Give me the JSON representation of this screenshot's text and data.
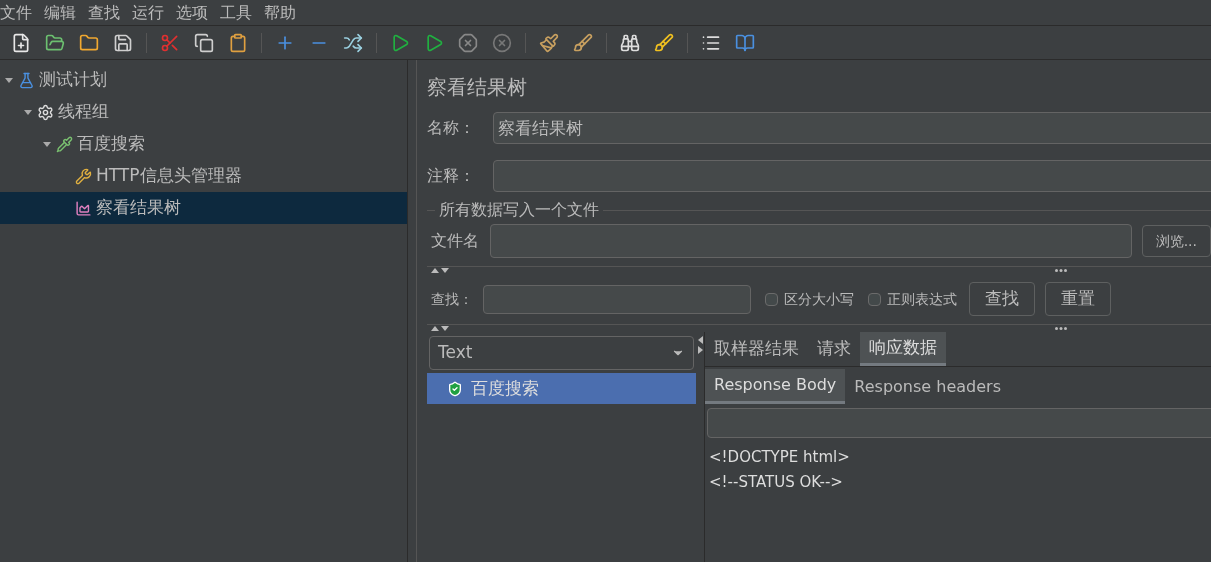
{
  "menu": [
    "文件",
    "编辑",
    "查找",
    "运行",
    "选项",
    "工具",
    "帮助"
  ],
  "tree": [
    {
      "label": "测试计划",
      "kind": "plan",
      "expanded": true,
      "selected": false,
      "children": [
        {
          "label": "线程组",
          "kind": "threads",
          "expanded": true,
          "selected": false,
          "children": [
            {
              "label": "百度搜索",
              "kind": "sampler",
              "expanded": true,
              "selected": false,
              "children": [
                {
                  "label": "HTTP信息头管理器",
                  "kind": "config",
                  "selected": false
                },
                {
                  "label": "察看结果树",
                  "kind": "listener",
                  "selected": true
                }
              ]
            }
          ]
        }
      ]
    }
  ],
  "panel": {
    "title": "察看结果树",
    "name_label": "名称：",
    "name_value": "察看结果树",
    "comment_label": "注释：",
    "file_group": {
      "title": "所有数据写入一个文件",
      "file_label": "文件名",
      "browse": "浏览..."
    },
    "search": {
      "label": "查找：",
      "options": [
        {
          "label": "区分大小写",
          "checked": false
        },
        {
          "label": "正则表达式",
          "checked": false
        }
      ],
      "buttons": [
        "查找",
        "重置"
      ]
    },
    "renderer": "Text",
    "results": [
      {
        "label": "百度搜索",
        "selected": true
      }
    ],
    "tabs": [
      {
        "label": "取样器结果",
        "selected": false
      },
      {
        "label": "请求",
        "selected": false
      },
      {
        "label": "响应数据",
        "selected": true
      }
    ],
    "subtabs": [
      {
        "label": "Response Body",
        "selected": true
      },
      {
        "label": "Response headers",
        "selected": false
      }
    ],
    "body": [
      "<!DOCTYPE html>",
      "<!--STATUS OK-->"
    ]
  }
}
